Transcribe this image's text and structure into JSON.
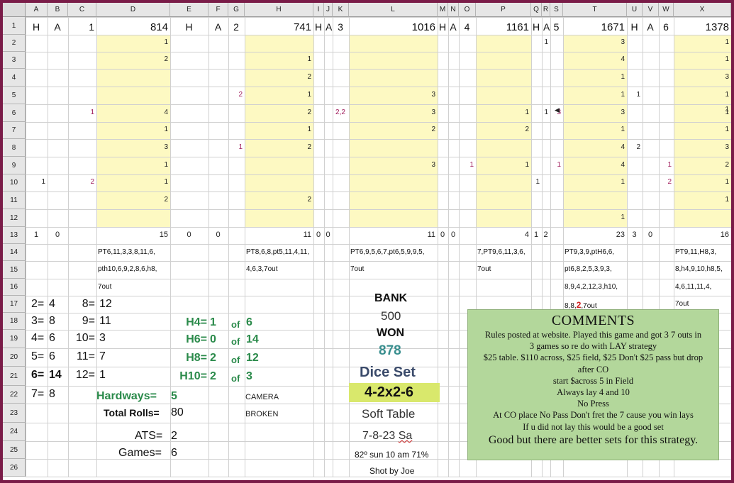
{
  "columns": [
    "A",
    "B",
    "C",
    "D",
    "E",
    "F",
    "G",
    "H",
    "I",
    "J",
    "K",
    "L",
    "M",
    "N",
    "O",
    "P",
    "Q",
    "R",
    "S",
    "T",
    "U",
    "V",
    "W",
    "X"
  ],
  "rows": [
    "1",
    "2",
    "3",
    "4",
    "5",
    "6",
    "7",
    "8",
    "9",
    "10",
    "11",
    "12",
    "13",
    "14",
    "15",
    "16",
    "17",
    "18",
    "19",
    "20",
    "21",
    "22",
    "23",
    "24",
    "25",
    "26"
  ],
  "header_row": [
    {
      "h": "H",
      "a": "A",
      "n": "1",
      "total": "814"
    },
    {
      "h": "H",
      "a": "A",
      "n": "2",
      "total": "741"
    },
    {
      "h": "H",
      "a": "3",
      "n": "",
      "total": "1016"
    },
    {
      "h": "H",
      "a": "A",
      "n": "4",
      "total": "1161"
    },
    {
      "h": "H",
      "a": "A",
      "n": "5",
      "total": "1671"
    },
    {
      "h": "H",
      "a": "A",
      "n": "6",
      "total": "1378"
    }
  ],
  "header_misc": {
    "j1": "A"
  },
  "game_values": {
    "d": [
      "1",
      "2",
      "",
      "",
      "4",
      "1",
      "3",
      "1",
      "1",
      "2",
      ""
    ],
    "h": [
      "",
      "1",
      "2",
      "1",
      "2",
      "1",
      "2",
      "",
      "",
      "2",
      ""
    ],
    "l": [
      "",
      "",
      "",
      "3",
      "3",
      "2",
      "",
      "3",
      "",
      "",
      ""
    ],
    "p": [
      "",
      "",
      "",
      "",
      "1",
      "2",
      "",
      "1",
      "",
      "",
      ""
    ],
    "t": [
      "3",
      "4",
      "1",
      "1",
      "3",
      "1",
      "4",
      "4",
      "1",
      "",
      "1"
    ],
    "x": [
      "1",
      "1",
      "3",
      "1",
      "1",
      "1",
      "3",
      "2",
      "1",
      "1",
      ""
    ],
    "x_extra_r6": "1"
  },
  "side_marks": {
    "c6": "1",
    "c10": "2",
    "a10": "1",
    "g5": "2",
    "g8": "1",
    "k6": "2,2",
    "o9": "1",
    "r2": "1",
    "r6": "1",
    "s6": "3",
    "s9": "1",
    "q10": "1",
    "u5": "1",
    "u8": "2",
    "w9": "1",
    "w10": "2"
  },
  "totals_row": {
    "a": "1",
    "b": "0",
    "d": "15",
    "e": "0",
    "f": "0",
    "h": "11",
    "i": "0",
    "j": "0",
    "l": "11",
    "m": "0",
    "n": "0",
    "p": "4",
    "q": "1",
    "r": "2",
    "t": "23",
    "u": "3",
    "v": "0",
    "x": "16"
  },
  "roll_notes": {
    "d": [
      "PT6,11,3,3,8,11,6,",
      "pth10,6,9,2,8,6,h8,",
      "7out"
    ],
    "h": [
      "PT8,6,8,pt5,11,4,11,",
      "4,6,3,7out"
    ],
    "l": [
      "PT6,9,5,6,7,pt6,5,9,9,5,",
      "7out"
    ],
    "p": [
      "7,PT9,6,11,3,6,",
      "7out"
    ],
    "t": [
      "PT9,3,9,ptH6,6,",
      "pt6,8,2,5,3,9,3,",
      "8,9,4,2,12,3,h10,",
      "8,8,",
      "2",
      ",7out"
    ],
    "x": [
      "PT9,11,H8,3,",
      "8,h4,9,10,h8,5,",
      "4,6,11,11,4,",
      "7out"
    ]
  },
  "number_stats": [
    {
      "a": "2=",
      "b": "4",
      "c": "8=",
      "d": "12"
    },
    {
      "a": "3=",
      "b": "8",
      "c": "9=",
      "d": "11"
    },
    {
      "a": "4=",
      "b": "6",
      "c": "10=",
      "d": "3"
    },
    {
      "a": "5=",
      "b": "6",
      "c": "11=",
      "d": "7"
    },
    {
      "a": "6=",
      "b": "14",
      "c": "12=",
      "d": "1"
    },
    {
      "a": "7=",
      "b": "8",
      "c": "",
      "d": ""
    }
  ],
  "hardways": [
    {
      "label": "H4=",
      "val": "1",
      "of": "of",
      "total": "6"
    },
    {
      "label": "H6=",
      "val": "0",
      "of": "of",
      "total": "14"
    },
    {
      "label": "H8=",
      "val": "2",
      "of": "of",
      "total": "12"
    },
    {
      "label": "H10=",
      "val": "2",
      "of": "of",
      "total": "3"
    }
  ],
  "summary": {
    "hardways_label": "Hardways=",
    "hardways_val": "5",
    "total_rolls_label": "Total Rolls=",
    "total_rolls_val": "80",
    "ats_label": "ATS=",
    "ats_val": "2",
    "games_label": "Games=",
    "games_val": "6",
    "camera": "CAMERA",
    "broken": "BROKEN"
  },
  "bank": {
    "bank_label": "BANK",
    "bank_val": "500",
    "won_label": "WON",
    "won_val": "878",
    "dice_set_label": "Dice Set",
    "dice_set_val": "4-2x2-6",
    "table": "Soft Table",
    "date_prefix": "7-8-23 ",
    "date_day": "Sa",
    "weather": "82º sun 10 am 71%",
    "shooter": "Shot by Joe"
  },
  "comments": {
    "title": "COMMENTS",
    "lines": [
      "Rules posted at website. Played this game and got 3 7 outs in",
      "3 games so re do with LAY strategy",
      "$25 table. $110 across, $25 field, $25 Don't $25 pass but drop",
      "after CO",
      "start $across 5 in Field",
      "Always lay 4 and 10",
      "No  Press",
      "At CO place No Pass  Don't fret the 7 cause you win lays",
      "If u did not lay this would be a good set"
    ],
    "closing": "Good but there are better sets for this strategy."
  },
  "colors": {
    "frame": "#7a1c48",
    "yellow_fill": "#fdf9c2",
    "comment_bg": "#b3d79b",
    "dice_set_bg": "#d9e86c",
    "green_text": "#2a8a4a",
    "magenta": "#a01c5c",
    "won_color": "#3a8f8f",
    "dice_set_color": "#3a4a6a"
  }
}
